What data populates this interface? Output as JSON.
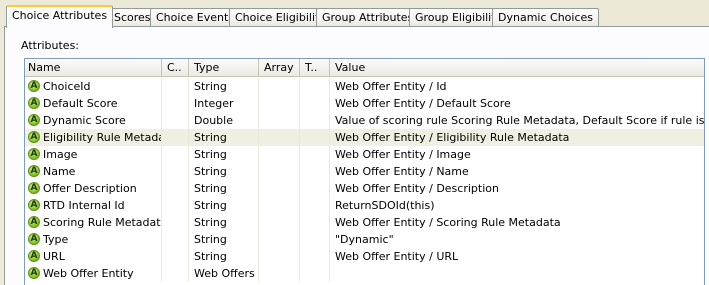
{
  "tabs": [
    {
      "label": "Choice Attributes",
      "active": true
    },
    {
      "label": "Scores",
      "active": false
    },
    {
      "label": "Choice Events",
      "active": false
    },
    {
      "label": "Choice Eligibility",
      "active": false
    },
    {
      "label": "Group Attributes",
      "active": false
    },
    {
      "label": "Group Eligibility",
      "active": false
    },
    {
      "label": "Dynamic Choices",
      "active": false
    }
  ],
  "attributes_label": "Attributes:",
  "columns": {
    "name": "Name",
    "c": "C..",
    "type": "Type",
    "array": "Array",
    "t": "T..",
    "value": "Value"
  },
  "attribute_icon_glyph": "A",
  "rows": [
    {
      "name": "ChoiceId",
      "type": "String",
      "value": "Web Offer Entity / Id"
    },
    {
      "name": "Default Score",
      "type": "Integer",
      "value": "Web Offer Entity / Default Score"
    },
    {
      "name": "Dynamic Score",
      "type": "Double",
      "value": "Value of scoring rule Scoring Rule Metadata, Default Score if rule is invalid."
    },
    {
      "name": "Eligibility Rule Metadata",
      "type": "String",
      "value": "Web Offer Entity / Eligibility Rule Metadata",
      "selected": true
    },
    {
      "name": "Image",
      "type": "String",
      "value": "Web Offer Entity / Image"
    },
    {
      "name": "Name",
      "type": "String",
      "value": "Web Offer Entity / Name"
    },
    {
      "name": "Offer Description",
      "type": "String",
      "value": "Web Offer Entity / Description"
    },
    {
      "name": "RTD Internal Id",
      "type": "String",
      "value": "ReturnSDOId(this)"
    },
    {
      "name": "Scoring Rule Metadata",
      "type": "String",
      "value": "Web Offer Entity / Scoring Rule Metadata"
    },
    {
      "name": "Type",
      "type": "String",
      "value": "\"Dynamic\""
    },
    {
      "name": "URL",
      "type": "String",
      "value": "Web Offer Entity / URL"
    },
    {
      "name": "Web Offer Entity",
      "type": "Web Offers",
      "value": ""
    }
  ]
}
